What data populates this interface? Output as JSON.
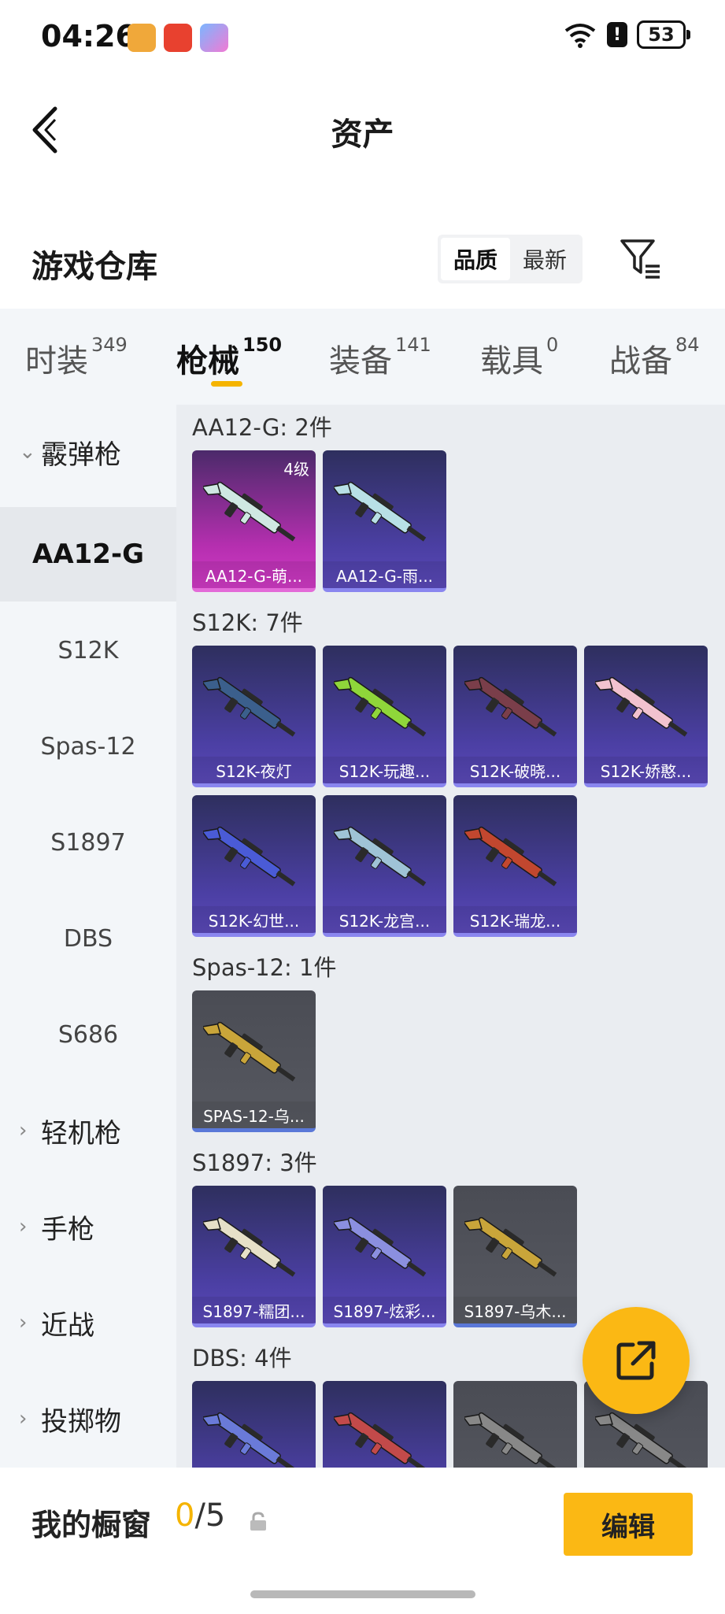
{
  "status_bar": {
    "time": "04:26",
    "battery": "53",
    "alert_glyph": "!",
    "app_icons": [
      "game-center-app-icon",
      "video-call-app-icon",
      "shopping-app-icon"
    ],
    "icons": [
      "wifi-icon",
      "alert-icon",
      "battery-icon"
    ]
  },
  "header": {
    "title": "资产",
    "back_icon": "back-arrow-icon"
  },
  "warehouse": {
    "title": "游戏仓库",
    "sort_options": [
      "品质",
      "最新"
    ],
    "sort_selected": "品质",
    "filter_icon": "filter-icon"
  },
  "tabs": [
    {
      "label": "时装",
      "count": "349"
    },
    {
      "label": "枪械",
      "count": "150",
      "active": true
    },
    {
      "label": "装备",
      "count": "141"
    },
    {
      "label": "载具",
      "count": "0"
    },
    {
      "label": "战备",
      "count": "84"
    }
  ],
  "sidebar": {
    "group_open": "霰弹枪",
    "items": [
      "AA12-G",
      "S12K",
      "Spas-12",
      "S1897",
      "DBS",
      "S686"
    ],
    "active_item": "AA12-G",
    "groups_collapsed": [
      "轻机枪",
      "手枪",
      "近战",
      "投掷物"
    ]
  },
  "sections": [
    {
      "title": "AA12-G: 2件",
      "items": [
        {
          "name": "AA12-G-萌...",
          "tier": "pink",
          "level": "4级",
          "gun_color": "#cfe8e2"
        },
        {
          "name": "AA12-G-雨...",
          "tier": "purple",
          "gun_color": "#b8e0e6"
        }
      ]
    },
    {
      "title": "S12K: 7件",
      "items": [
        {
          "name": "S12K-夜灯",
          "tier": "purple",
          "gun_color": "#3b5f8c"
        },
        {
          "name": "S12K-玩趣...",
          "tier": "purple",
          "gun_color": "#8fd63a"
        },
        {
          "name": "S12K-破晓...",
          "tier": "purple",
          "gun_color": "#7a3e4a"
        },
        {
          "name": "S12K-娇憨...",
          "tier": "purple",
          "gun_color": "#f2c2cf"
        },
        {
          "name": "S12K-幻世...",
          "tier": "purple",
          "gun_color": "#4a5bd6"
        },
        {
          "name": "S12K-龙宫...",
          "tier": "purple",
          "gun_color": "#9fc3d6"
        },
        {
          "name": "S12K-瑞龙...",
          "tier": "purple",
          "gun_color": "#c2472f"
        }
      ]
    },
    {
      "title": "Spas-12: 1件",
      "items": [
        {
          "name": "SPAS-12-乌...",
          "tier": "gray",
          "gun_color": "#c9a53a"
        }
      ]
    },
    {
      "title": "S1897: 3件",
      "items": [
        {
          "name": "S1897-糯团...",
          "tier": "purple",
          "gun_color": "#e6e0c8"
        },
        {
          "name": "S1897-炫彩...",
          "tier": "purple",
          "gun_color": "#8b8fe0"
        },
        {
          "name": "S1897-乌木...",
          "tier": "gray",
          "gun_color": "#c9a53a"
        }
      ]
    },
    {
      "title": "DBS: 4件",
      "items": [
        {
          "name": "",
          "tier": "purple",
          "gun_color": "#6a7ad8"
        },
        {
          "name": "",
          "tier": "purple",
          "gun_color": "#c24a4a"
        },
        {
          "name": "",
          "tier": "gray",
          "gun_color": "#888888"
        },
        {
          "name": "",
          "tier": "gray",
          "gun_color": "#888888"
        }
      ]
    }
  ],
  "fab": {
    "icon": "share-external-icon"
  },
  "bottom_bar": {
    "label": "我的橱窗",
    "count_current": "0",
    "count_total": "/5",
    "lock_icon": "lock-icon",
    "edit_label": "编辑"
  },
  "colors": {
    "accent": "#fbb814",
    "tab_bg": "#f3f6f9",
    "content_bg": "#eaedf1"
  }
}
